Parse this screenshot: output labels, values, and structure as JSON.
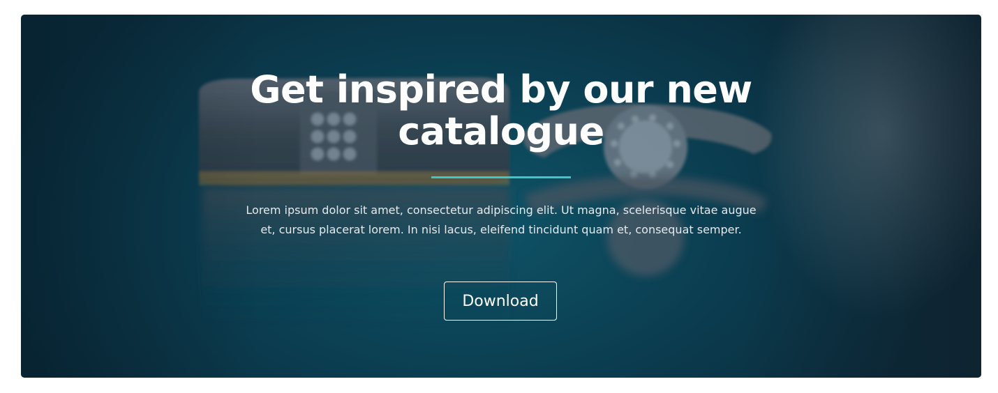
{
  "banner": {
    "title": "Get inspired by our new catalogue",
    "description": "Lorem ipsum dolor sit amet, consectetur adipiscing elit. Ut magna, scelerisque vitae augue et, cursus placerat lorem. In nisi lacus, eleifend tincidunt quam et, consequat semper.",
    "button_label": "Download",
    "background_image": "wedding-rings-photo",
    "accent_color": "#3fc6c8",
    "background_color": "#0b3d50"
  }
}
